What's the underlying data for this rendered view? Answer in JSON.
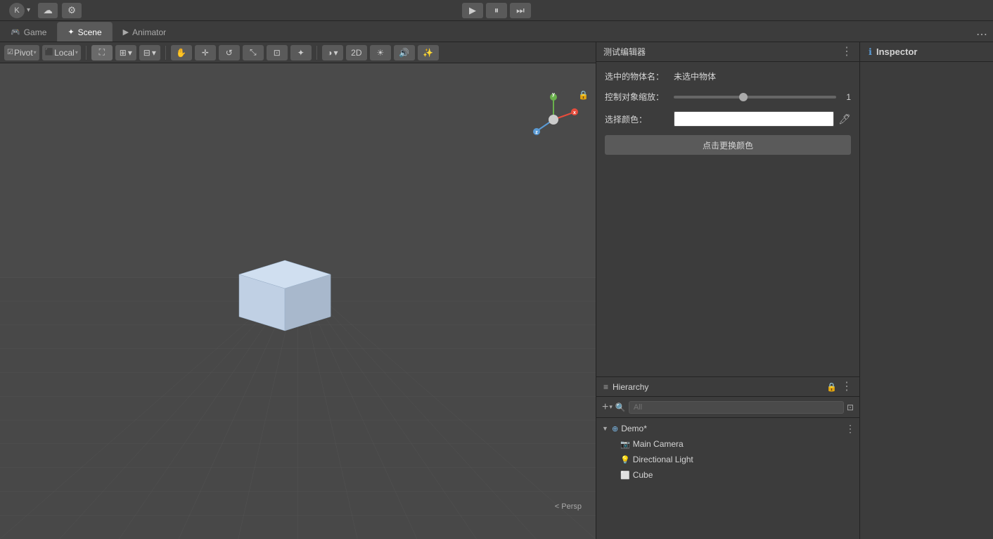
{
  "topbar": {
    "user_initial": "K",
    "account_arrow": "▾",
    "cloud_icon": "☁",
    "settings_icon": "⚙",
    "play_icon": "▶",
    "pause_icon": "⏸",
    "step_icon": "⏭"
  },
  "tabs": [
    {
      "id": "game",
      "label": "Game",
      "icon": "🎮",
      "active": false
    },
    {
      "id": "scene",
      "label": "Scene",
      "icon": "✦",
      "active": true
    },
    {
      "id": "animator",
      "label": "Animator",
      "icon": "▶",
      "active": false
    }
  ],
  "scene_toolbar": {
    "pivot_label": "Pivot",
    "local_label": "Local"
  },
  "scene": {
    "persp_label": "< Persp"
  },
  "editor_panel": {
    "title": "测试编辑器",
    "selected_label": "选中的物体名：",
    "selected_value": "未选中物体",
    "scale_label": "控制对象缩放：",
    "scale_value": "1",
    "color_label": "选择颜色：",
    "change_color_btn": "点击更换颜色"
  },
  "inspector": {
    "title": "Inspector",
    "icon": "ℹ"
  },
  "hierarchy": {
    "title": "Hierarchy",
    "search_placeholder": "All",
    "scene_name": "Demo*",
    "items": [
      {
        "id": "main-camera",
        "label": "Main Camera",
        "indent": true
      },
      {
        "id": "directional-light",
        "label": "Directional Light",
        "indent": true
      },
      {
        "id": "cube",
        "label": "Cube",
        "indent": true
      }
    ]
  }
}
